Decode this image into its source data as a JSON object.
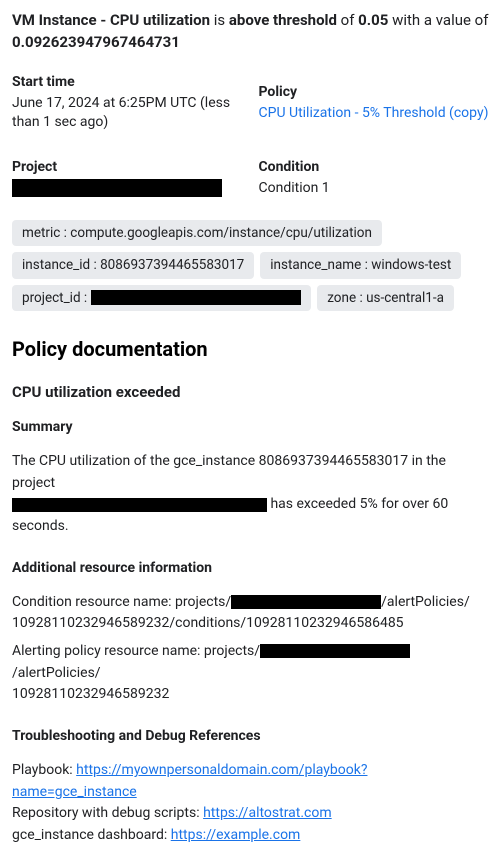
{
  "headline": {
    "prefix_bold": "VM Instance - CPU utilization",
    "mid1": " is ",
    "state_bold": "above threshold",
    "mid2": " of ",
    "threshold_bold": "0.05",
    "mid3": " with a value of ",
    "value_bold": "0.092623947967464731"
  },
  "meta": {
    "start_time_label": "Start time",
    "start_time_value": "June 17, 2024 at 6:25PM UTC (less than 1 sec ago)",
    "policy_label": "Policy",
    "policy_link": "CPU Utilization - 5% Threshold (copy)",
    "project_label": "Project",
    "condition_label": "Condition",
    "condition_value": "Condition 1"
  },
  "chips": {
    "metric": "metric : compute.googleapis.com/instance/cpu/utilization",
    "instance_id": "instance_id : 8086937394465583017",
    "instance_name": "instance_name : windows-test",
    "project_id_prefix": "project_id :",
    "zone": "zone : us-central1-a"
  },
  "doc": {
    "heading": "Policy documentation",
    "sub1": "CPU utilization exceeded",
    "summary_label": "Summary",
    "summary_line1_prefix": "The CPU utilization of the gce_instance 8086937394465583017 in the project",
    "summary_line2_suffix": " has exceeded 5% for over 60 seconds.",
    "addl_label": "Additional resource information",
    "cond_res_prefix": "Condition resource name: projects/",
    "cond_res_suffix": "/alertPolicies/\n10928110232946589232/conditions/10928110232946586485",
    "alert_res_prefix": "Alerting policy resource name: projects/",
    "alert_res_suffix": "/alertPolicies/\n10928110232946589232",
    "troubleshoot_label": "Troubleshooting and Debug References",
    "playbook_label": "Playbook: ",
    "playbook_link": "https://myownpersonaldomain.com/playbook?name=gce_instance",
    "repo_label": "Repository with debug scripts: ",
    "repo_link": "https://altostrat.com",
    "dash_label": "gce_instance dashboard: ",
    "dash_link": "https://example.com"
  }
}
